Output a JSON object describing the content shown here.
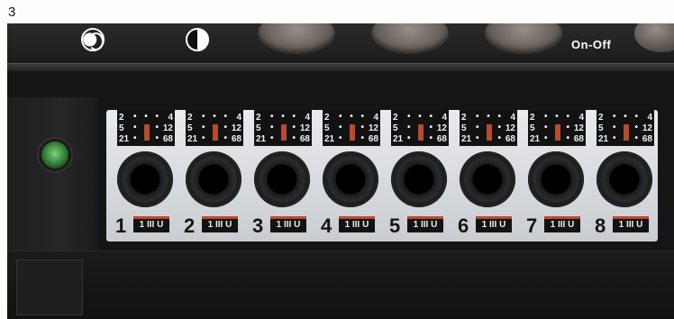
{
  "figure_number": "3",
  "top_strip": {
    "on_off_label": "On-Off",
    "icons": [
      "moon-icon",
      "half-circle-icon"
    ]
  },
  "switch_rows": [
    {
      "left": "2",
      "right": "4"
    },
    {
      "left": "5",
      "right": "12"
    },
    {
      "left": "21",
      "right": "68"
    }
  ],
  "jacks": [
    {
      "number": "1",
      "label": "1 III U"
    },
    {
      "number": "2",
      "label": "1 III U"
    },
    {
      "number": "3",
      "label": "1 III U"
    },
    {
      "number": "4",
      "label": "1 III U"
    },
    {
      "number": "5",
      "label": "1 III U"
    },
    {
      "number": "6",
      "label": "1 III U"
    },
    {
      "number": "7",
      "label": "1 III U"
    },
    {
      "number": "8",
      "label": "1 III U"
    }
  ],
  "colors": {
    "device": "#151515",
    "panel": "#dfe1e4",
    "switch_marker": "#b84a30",
    "indicator": "#5cb85c"
  }
}
